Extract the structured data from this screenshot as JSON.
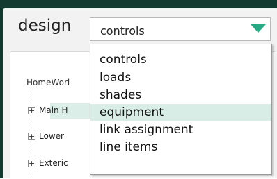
{
  "header": {
    "title": "design"
  },
  "select": {
    "value": "controls",
    "arrow_color": "#2aa985"
  },
  "tree": {
    "root": "HomeWorl",
    "rows": [
      "Main H",
      "Lower",
      "Exteric"
    ]
  },
  "dropdown": {
    "options": [
      "controls",
      "loads",
      "shades",
      "equipment",
      "link assignment",
      "line items"
    ],
    "hovered": "equipment"
  },
  "colors": {
    "frame": "#123a30",
    "highlight": "#d8ede6"
  }
}
